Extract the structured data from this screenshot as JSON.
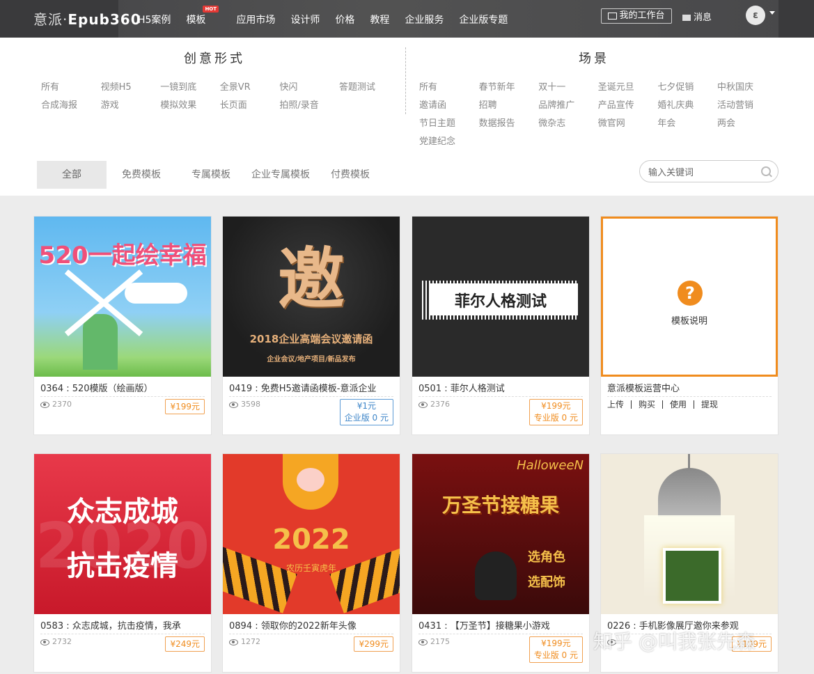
{
  "header": {
    "logo_cn": "意派",
    "logo_en": "Epub360",
    "nav": [
      "H5案例",
      "模板",
      "应用市场",
      "设计师",
      "价格",
      "教程",
      "企业服务",
      "企业版专题"
    ],
    "hot_badge": "HOT",
    "workspace_label": "我的工作台",
    "messages_label": "消息",
    "avatar_letter": "ε"
  },
  "filters": {
    "form_title": "创意形式",
    "form_items": [
      "所有",
      "视频H5",
      "一镜到底",
      "全景VR",
      "快闪",
      "答题测试",
      "合成海报",
      "游戏",
      "模拟效果",
      "长页面",
      "拍照/录音"
    ],
    "scene_title": "场景",
    "scene_items": [
      "所有",
      "春节新年",
      "双十一",
      "圣诞元旦",
      "七夕促销",
      "中秋国庆",
      "邀请函",
      "招聘",
      "品牌推广",
      "产品宣传",
      "婚礼庆典",
      "活动营销",
      "节日主题",
      "数据报告",
      "微杂志",
      "微官网",
      "年会",
      "两会",
      "党建纪念"
    ],
    "tabs": [
      "全部",
      "免费模板",
      "专属模板",
      "企业专属模板",
      "付费模板"
    ],
    "search_placeholder": "输入关键词"
  },
  "cards": [
    {
      "title": "0364 : 520模版（绘画版）",
      "views": "2370",
      "price": "¥199元",
      "thumb_text": "520一起绘幸福"
    },
    {
      "title": "0419 : 免费H5邀请函模板-意派企业",
      "views": "3598",
      "price": "¥1元",
      "price_sub": "企业版 0 元",
      "thumb_big": "邀",
      "thumb_text": "2018企业高端会议邀请函",
      "thumb_sub": "企业会议/地产项目/新品发布"
    },
    {
      "title": "0501 : 菲尔人格测试",
      "views": "2376",
      "price": "¥199元",
      "price_sub": "专业版 0 元",
      "thumb_text": "菲尔人格测试"
    },
    {
      "title": "意派模板运营中心",
      "help_label": "模板说明",
      "actions": [
        "上传",
        "购买",
        "使用",
        "提现"
      ]
    },
    {
      "title": "0583 : 众志成城，抗击疫情，我承",
      "views": "2732",
      "price": "¥249元",
      "thumb_text": "众志成城",
      "thumb_text2": "抗击疫情",
      "thumb_bg": "2020"
    },
    {
      "title": "0894 : 领取你的2022新年头像",
      "views": "1272",
      "price": "¥299元",
      "thumb_text": "2022",
      "thumb_sub": "农历壬寅虎年"
    },
    {
      "title": "0431 : 【万圣节】接糖果小游戏",
      "views": "2175",
      "price": "¥199元",
      "price_sub": "专业版 0 元",
      "thumb_corner": "HalloweeN",
      "thumb_text": "万圣节接糖果",
      "thumb_sub": "选角色",
      "thumb_sub2": "选配饰"
    },
    {
      "title": "0226 : 手机影像展厅邀你来参观",
      "views": "",
      "price": "¥199元"
    }
  ],
  "watermark": "知乎 @叫我张先森"
}
